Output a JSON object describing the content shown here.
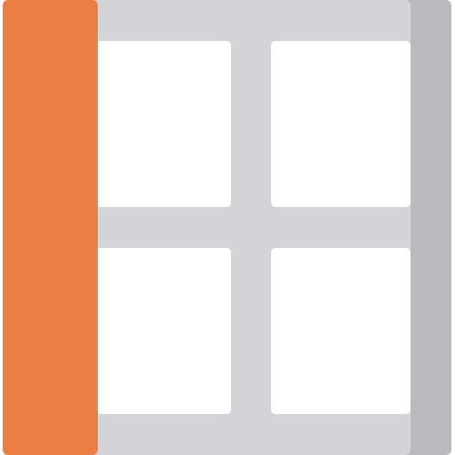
{
  "icon": {
    "name": "sidebar-layout-window-icon",
    "colors": {
      "accent": "#EB7E43",
      "frame": "#D3D3D8",
      "frame_shadow": "#B9B9BE",
      "pane": "#FFFFFF"
    }
  }
}
